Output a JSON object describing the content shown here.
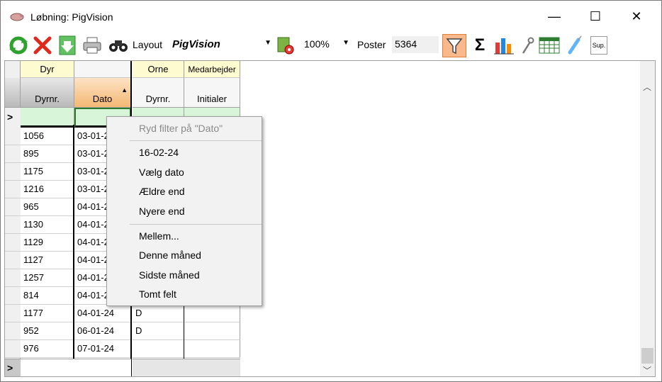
{
  "window": {
    "title": "Løbning: PigVision",
    "minimize": "—",
    "maximize": "☐",
    "close": "✕"
  },
  "toolbar": {
    "layout_label": "Layout",
    "layout_value": "PigVision",
    "zoom_value": "100%",
    "poster_label": "Poster",
    "poster_value": "5364",
    "sum_symbol": "Σ",
    "sup_label": "Sup."
  },
  "grid": {
    "groups": [
      "Dyr",
      "",
      "Orne",
      "Medarbejder"
    ],
    "columns": [
      "Dyrnr.",
      "Dato",
      "Dyrnr.",
      "Initialer"
    ],
    "sort_indicator": "▲",
    "row_indicator": ">",
    "rows": [
      {
        "dyrnr": "1056",
        "dato": "03-01-2",
        "orne": "",
        "init": ""
      },
      {
        "dyrnr": "895",
        "dato": "03-01-2",
        "orne": "",
        "init": ""
      },
      {
        "dyrnr": "1175",
        "dato": "03-01-2",
        "orne": "",
        "init": ""
      },
      {
        "dyrnr": "1216",
        "dato": "03-01-2",
        "orne": "",
        "init": ""
      },
      {
        "dyrnr": "965",
        "dato": "04-01-2",
        "orne": "",
        "init": ""
      },
      {
        "dyrnr": "1130",
        "dato": "04-01-2",
        "orne": "",
        "init": ""
      },
      {
        "dyrnr": "1129",
        "dato": "04-01-2",
        "orne": "",
        "init": ""
      },
      {
        "dyrnr": "1127",
        "dato": "04-01-2",
        "orne": "",
        "init": ""
      },
      {
        "dyrnr": "1257",
        "dato": "04-01-2",
        "orne": "",
        "init": ""
      },
      {
        "dyrnr": "814",
        "dato": "04-01-2",
        "orne": "",
        "init": ""
      },
      {
        "dyrnr": "1177",
        "dato": "04-01-24",
        "orne": "D",
        "init": ""
      },
      {
        "dyrnr": "952",
        "dato": "06-01-24",
        "orne": "D",
        "init": ""
      },
      {
        "dyrnr": "976",
        "dato": "07-01-24",
        "orne": "",
        "init": ""
      }
    ]
  },
  "context_menu": {
    "clear_filter": "Ryd filter på \"Dato\"",
    "items_group1": [
      "16-02-24",
      "Vælg dato",
      "Ældre end",
      "Nyere end"
    ],
    "items_group2": [
      "Mellem...",
      "Denne måned",
      "Sidste måned",
      "Tomt felt"
    ]
  },
  "colors": {
    "group_header_bg": "#fffbd0",
    "filter_row_bg": "#d9f5d9",
    "filter_button_active": "#f9b98c",
    "sorted_header": "#f4b774"
  }
}
